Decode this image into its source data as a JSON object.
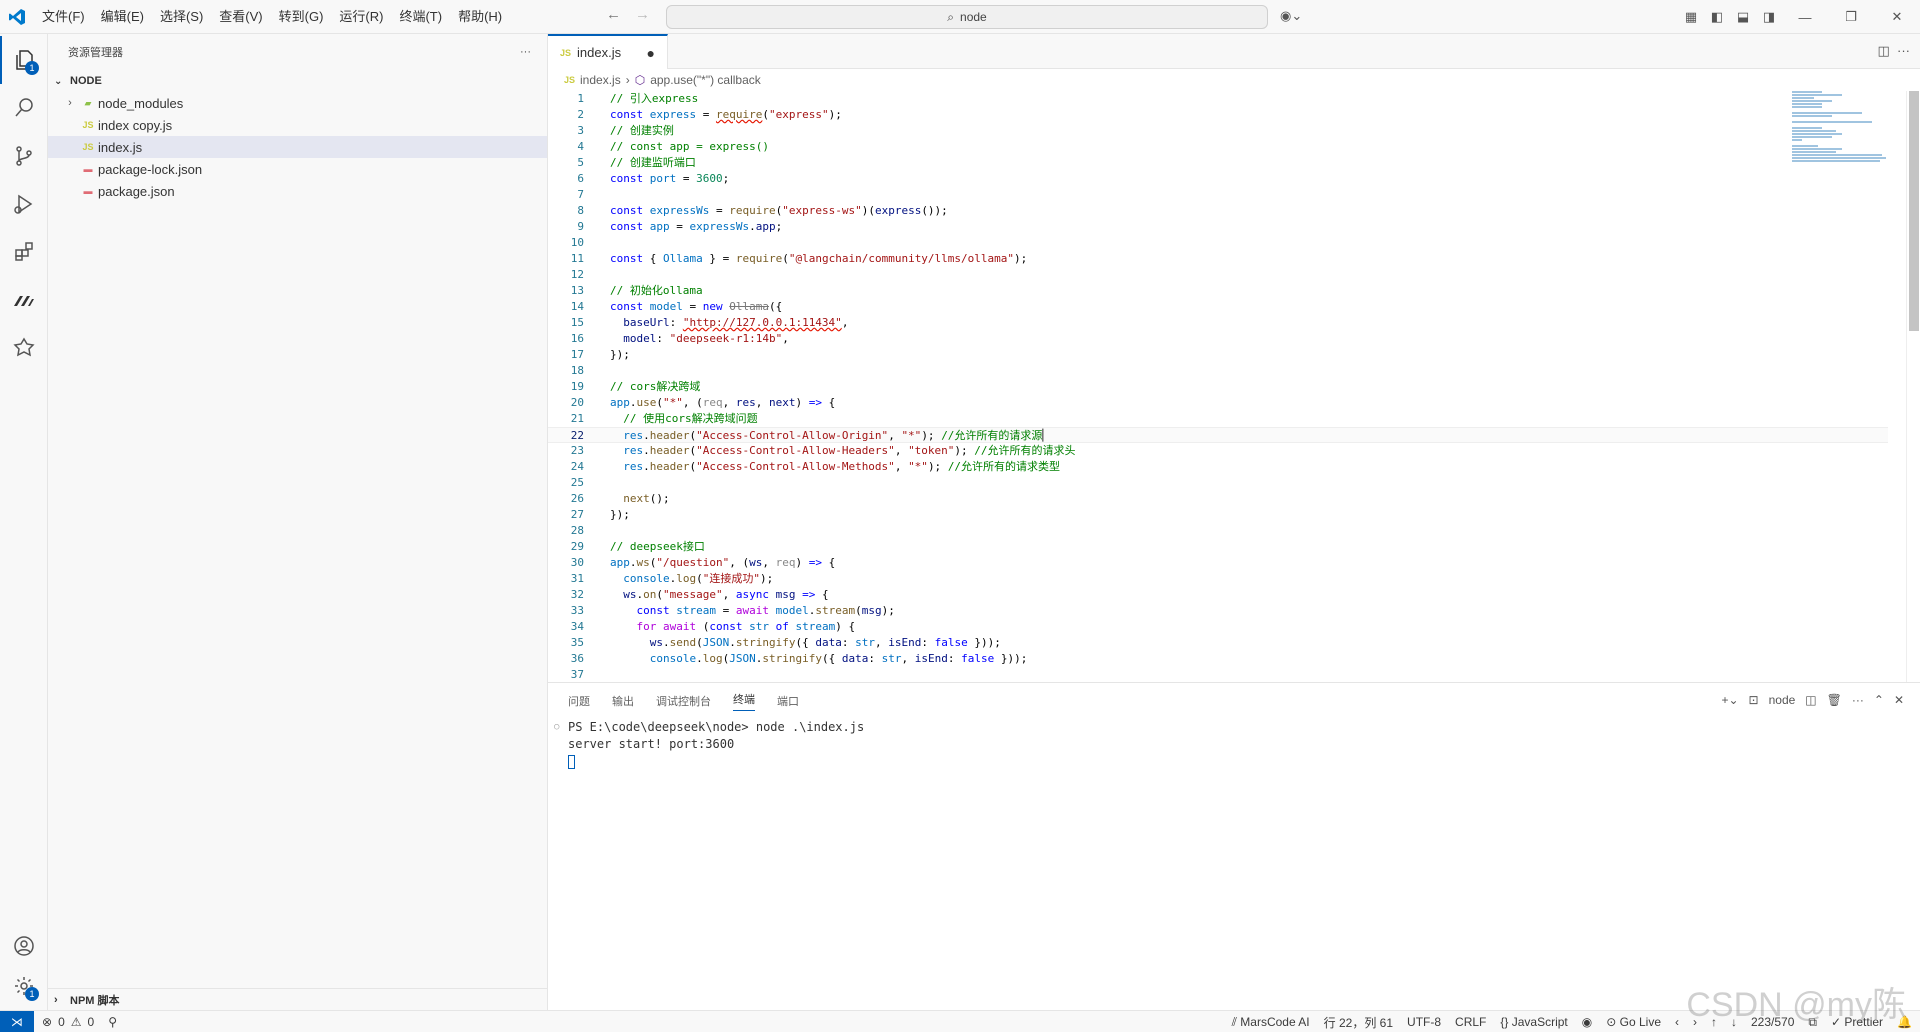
{
  "titlebar": {
    "menu": [
      "文件(F)",
      "编辑(E)",
      "选择(S)",
      "查看(V)",
      "转到(G)",
      "运行(R)",
      "终端(T)",
      "帮助(H)"
    ],
    "search_text": "node"
  },
  "activity": {
    "explorer_badge": "1",
    "settings_badge": "1"
  },
  "sidebar": {
    "title": "资源管理器",
    "more": "···",
    "section": "NODE",
    "items": [
      {
        "label": "node_modules",
        "type": "folder"
      },
      {
        "label": "index copy.js",
        "type": "js"
      },
      {
        "label": "index.js",
        "type": "js",
        "selected": true
      },
      {
        "label": "package-lock.json",
        "type": "json"
      },
      {
        "label": "package.json",
        "type": "json"
      }
    ],
    "npm_section": "NPM 脚本"
  },
  "editor": {
    "tab_label": "index.js",
    "tab_prefix": "JS",
    "breadcrumb_file": "index.js",
    "breadcrumb_symbol": "app.use(\"*\") callback",
    "current_line": 22
  },
  "panel": {
    "tabs": [
      "问题",
      "输出",
      "调试控制台",
      "终端",
      "端口"
    ],
    "active_tab": "终端",
    "terminal_name": "node",
    "lines": [
      "PS E:\\code\\deepseek\\node> node .\\index.js",
      "server start! port:3600"
    ]
  },
  "statusbar": {
    "errors": "0",
    "warnings": "0",
    "marscode": "MarsCode AI",
    "position": "行 22，列 61",
    "encoding": "UTF-8",
    "eol": "CRLF",
    "language": "JavaScript",
    "golive": "Go Live",
    "count": "223/570",
    "prettier": "Prettier"
  },
  "watermark": "CSDN @my陈"
}
